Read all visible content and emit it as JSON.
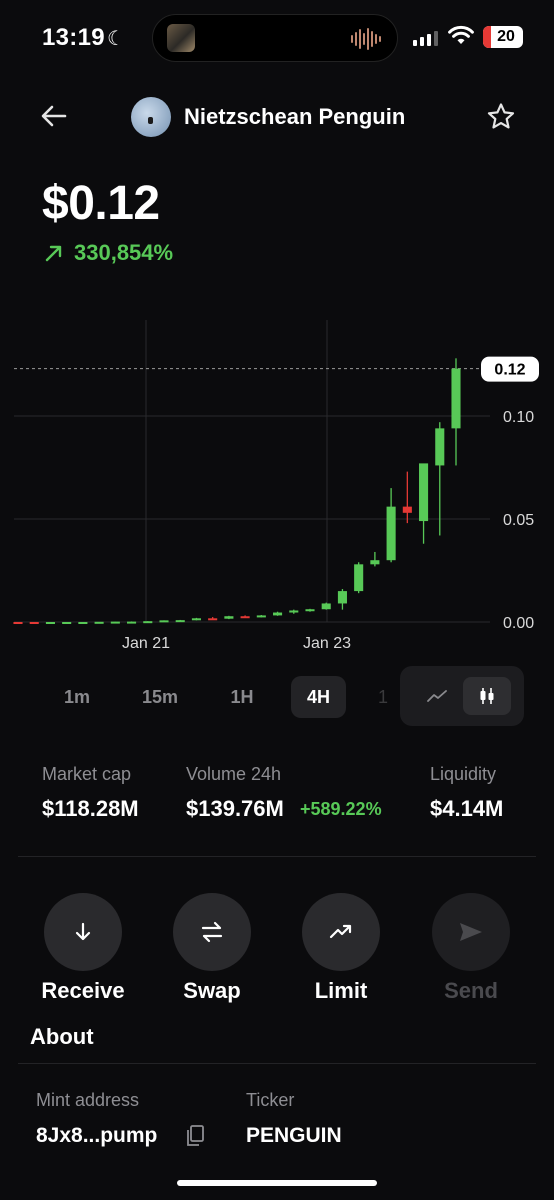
{
  "status_bar": {
    "time": "13:19",
    "battery": "20"
  },
  "header": {
    "coin_name": "Nietzschean Penguin",
    "back_icon": "arrow-left-icon",
    "star_icon": "star-icon"
  },
  "price": {
    "value": "$0.12",
    "change": "330,854%"
  },
  "chart_data": {
    "type": "candlestick",
    "x_labels": [
      "Jan 21",
      "Jan 23"
    ],
    "y_ticks": [
      "0.12",
      "0.10",
      "0.05",
      "0.00"
    ],
    "ylim": [
      0,
      0.12
    ],
    "current_price_label": "0.12",
    "up_color": "#58c957",
    "down_color": "#e53935",
    "candles": [
      {
        "o": 0.0,
        "h": 0.0,
        "l": 0.0,
        "c": 0.0,
        "dir": "down"
      },
      {
        "o": 0.0,
        "h": 0.0,
        "l": 0.0,
        "c": 0.0,
        "dir": "down"
      },
      {
        "o": 0.0,
        "h": 0.0,
        "l": 0.0,
        "c": 0.0,
        "dir": "up"
      },
      {
        "o": 0.0,
        "h": 0.0,
        "l": 0.0,
        "c": 0.0,
        "dir": "up"
      },
      {
        "o": 0.0,
        "h": 0.0,
        "l": 0.0,
        "c": 0.0,
        "dir": "up"
      },
      {
        "o": 0.0,
        "h": 0.0,
        "l": 0.0,
        "c": 0.0001,
        "dir": "up"
      },
      {
        "o": 0.0001,
        "h": 0.0002,
        "l": 0.0001,
        "c": 0.0002,
        "dir": "up"
      },
      {
        "o": 0.0002,
        "h": 0.0003,
        "l": 0.0001,
        "c": 0.0002,
        "dir": "up"
      },
      {
        "o": 0.0002,
        "h": 0.0004,
        "l": 0.0002,
        "c": 0.0004,
        "dir": "up"
      },
      {
        "o": 0.0004,
        "h": 0.0008,
        "l": 0.0004,
        "c": 0.0008,
        "dir": "up"
      },
      {
        "o": 0.0008,
        "h": 0.001,
        "l": 0.0007,
        "c": 0.0009,
        "dir": "up"
      },
      {
        "o": 0.001,
        "h": 0.002,
        "l": 0.0008,
        "c": 0.0018,
        "dir": "up"
      },
      {
        "o": 0.0018,
        "h": 0.0024,
        "l": 0.0014,
        "c": 0.0016,
        "dir": "down"
      },
      {
        "o": 0.0016,
        "h": 0.003,
        "l": 0.0014,
        "c": 0.0028,
        "dir": "up"
      },
      {
        "o": 0.0028,
        "h": 0.0032,
        "l": 0.0022,
        "c": 0.0024,
        "dir": "down"
      },
      {
        "o": 0.0024,
        "h": 0.0034,
        "l": 0.0022,
        "c": 0.0032,
        "dir": "up"
      },
      {
        "o": 0.0032,
        "h": 0.005,
        "l": 0.003,
        "c": 0.0046,
        "dir": "up"
      },
      {
        "o": 0.0046,
        "h": 0.006,
        "l": 0.004,
        "c": 0.0056,
        "dir": "up"
      },
      {
        "o": 0.0056,
        "h": 0.0064,
        "l": 0.005,
        "c": 0.0062,
        "dir": "up"
      },
      {
        "o": 0.0062,
        "h": 0.0094,
        "l": 0.006,
        "c": 0.009,
        "dir": "up"
      },
      {
        "o": 0.009,
        "h": 0.016,
        "l": 0.006,
        "c": 0.015,
        "dir": "up"
      },
      {
        "o": 0.015,
        "h": 0.029,
        "l": 0.014,
        "c": 0.028,
        "dir": "up"
      },
      {
        "o": 0.028,
        "h": 0.034,
        "l": 0.027,
        "c": 0.03,
        "dir": "up"
      },
      {
        "o": 0.03,
        "h": 0.065,
        "l": 0.029,
        "c": 0.056,
        "dir": "up"
      },
      {
        "o": 0.056,
        "h": 0.073,
        "l": 0.048,
        "c": 0.053,
        "dir": "down"
      },
      {
        "o": 0.049,
        "h": 0.074,
        "l": 0.038,
        "c": 0.077,
        "dir": "up"
      },
      {
        "o": 0.076,
        "h": 0.097,
        "l": 0.042,
        "c": 0.094,
        "dir": "up"
      },
      {
        "o": 0.094,
        "h": 0.128,
        "l": 0.076,
        "c": 0.123,
        "dir": "up"
      }
    ]
  },
  "timeframes": [
    {
      "label": "1m",
      "active": false
    },
    {
      "label": "15m",
      "active": false
    },
    {
      "label": "1H",
      "active": false
    },
    {
      "label": "4H",
      "active": true
    }
  ],
  "stats": {
    "market_cap": {
      "label": "Market cap",
      "value": "$118.28M"
    },
    "volume": {
      "label": "Volume 24h",
      "value": "$139.76M",
      "change": "+589.22%"
    },
    "liquidity": {
      "label": "Liquidity",
      "value": "$4.14M"
    }
  },
  "actions": [
    {
      "label": "Receive",
      "icon": "arrow-down-icon",
      "enabled": true
    },
    {
      "label": "Swap",
      "icon": "swap-icon",
      "enabled": true
    },
    {
      "label": "Limit",
      "icon": "trend-up-icon",
      "enabled": true
    },
    {
      "label": "Send",
      "icon": "send-icon",
      "enabled": false
    }
  ],
  "about": {
    "title": "About",
    "mint_label": "Mint address",
    "mint_value": "8Jx8...pump",
    "ticker_label": "Ticker",
    "ticker_value": "PENGUIN"
  }
}
